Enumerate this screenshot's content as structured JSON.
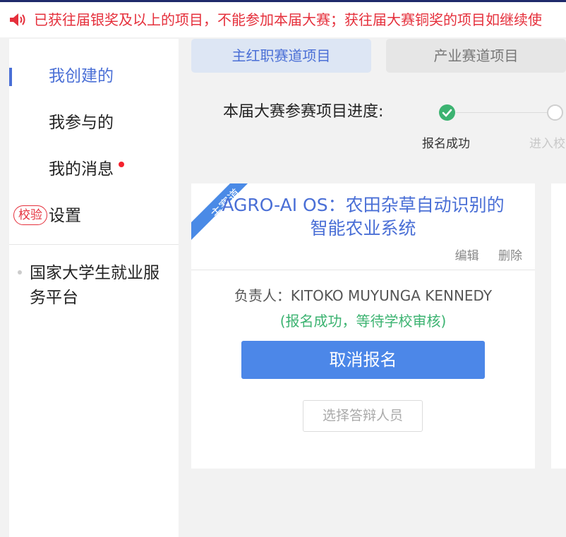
{
  "notice": {
    "text": "已获往届银奖及以上的项目，不能参加本届大赛；获往届大赛铜奖的项目如继续使",
    "icon": "speaker-icon",
    "color": "#e5303c"
  },
  "sidebar": {
    "items": [
      {
        "label": "我创建的",
        "active": true
      },
      {
        "label": "我参与的"
      },
      {
        "label": "我的消息",
        "has_notification": true
      },
      {
        "badge": "校验",
        "label": "设置"
      }
    ],
    "link": {
      "label": "国家大学生就业服务平台"
    }
  },
  "tabs": [
    {
      "label": "主红职赛道项目",
      "active": true
    },
    {
      "label": "产业赛道项目"
    }
  ],
  "progress": {
    "label": "本届大赛参赛项目进度:",
    "steps": [
      {
        "label": "报名成功",
        "done": true
      },
      {
        "label": "进入校",
        "done": false
      }
    ]
  },
  "card": {
    "ribbon": "主赛道",
    "title": "AGRO-AI OS：农田杂草自动识别的智能农业系统",
    "edit_label": "编辑",
    "delete_label": "删除",
    "owner": "负责人：KITOKO MUYUNGA KENNEDY",
    "status": "(报名成功，等待学校审核)",
    "cancel_button": "取消报名",
    "select_button": "选择答辩人员"
  },
  "colors": {
    "accent": "#4a6fd6",
    "primary_button": "#4c87e8",
    "success": "#3cb371",
    "warning_text": "#e5303c"
  }
}
